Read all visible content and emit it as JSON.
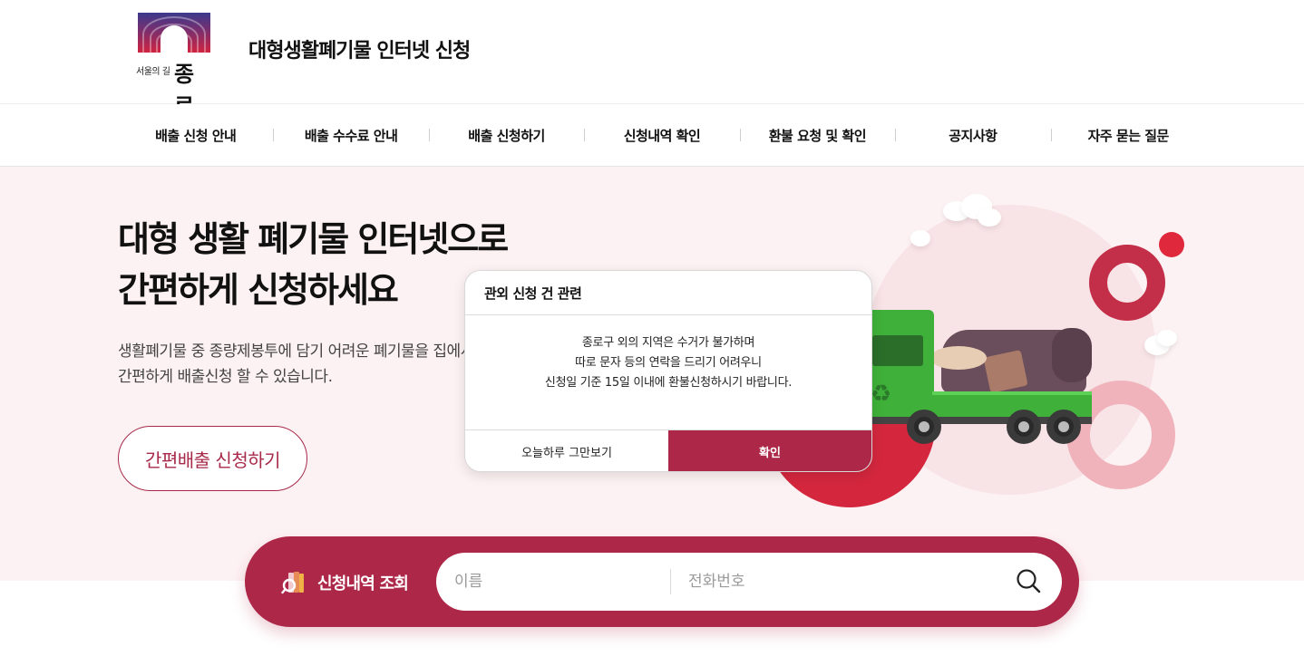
{
  "header": {
    "logo_sub": "서울의 길",
    "logo_main": "종로",
    "site_title": "대형생활폐기물 인터넷 신청"
  },
  "nav": {
    "items": [
      {
        "label": "배출 신청 안내"
      },
      {
        "label": "배출 수수료 안내"
      },
      {
        "label": "배출 신청하기"
      },
      {
        "label": "신청내역 확인"
      },
      {
        "label": "환불 요청 및 확인"
      },
      {
        "label": "공지사항"
      },
      {
        "label": "자주 묻는 질문"
      }
    ]
  },
  "hero": {
    "title_line1": "대형 생활 폐기물 인터넷으로",
    "title_line2": "간편하게 신청하세요",
    "desc_line1": "생활폐기물 중 종량제봉투에 담기 어려운 폐기물을 집에서",
    "desc_line2": "간편하게 배출신청 할 수 있습니다.",
    "cta_label": "간편배출 신청하기"
  },
  "modal": {
    "title": "관외 신청 건 관련",
    "body_line1": "종로구 외의 지역은 수거가 불가하며",
    "body_line2": "따로 문자 등의 연락을 드리기 어려우니",
    "body_line3": "신청일 기준 15일 이내에 환불신청하시기 바랍니다.",
    "skip_label": "오늘하루 그만보기",
    "ok_label": "확인"
  },
  "search": {
    "label": "신청내역 조회",
    "icon": "book-search-icon",
    "name_placeholder": "이름",
    "name_value": "",
    "phone_placeholder": "전화번호",
    "phone_value": "",
    "submit_icon": "magnifier-icon"
  },
  "colors": {
    "brand": "#ad2848",
    "hero_bg": "#fdf2f3",
    "accent_red": "#d4273e",
    "truck_green": "#3fb13a"
  }
}
